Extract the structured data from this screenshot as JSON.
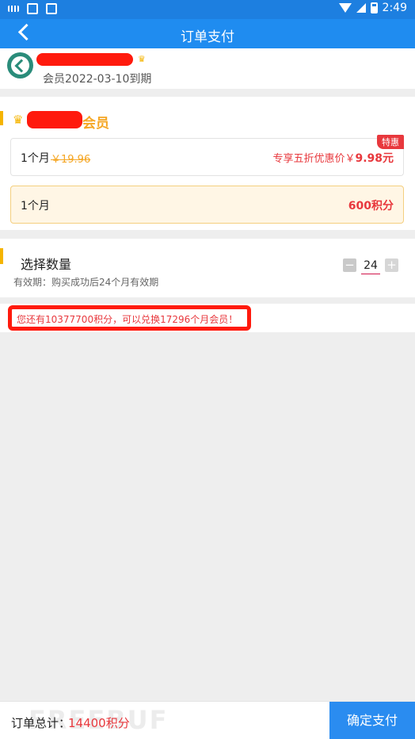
{
  "status_bar": {
    "time": "2:49",
    "icons": [
      "keyboard-icon",
      "image-icon",
      "a-icon",
      "wifi-icon",
      "signal-icon",
      "battery-icon"
    ]
  },
  "nav": {
    "title": "订单支付",
    "back_icon": "chevron-left-icon"
  },
  "user": {
    "expire": "会员2022-03-10到期"
  },
  "member": {
    "title_suffix": "会员",
    "option_price": {
      "label": "1个月",
      "original": "￥19.96",
      "promo_prefix": "专享五折优惠价￥",
      "promo_value": "9.98元",
      "badge": "特惠"
    },
    "option_points": {
      "label": "1个月",
      "points": "600积分"
    }
  },
  "quantity": {
    "title": "选择数量",
    "validity": "有效期：购买成功后24个月有效期",
    "value": "24",
    "minus": "−",
    "plus": "+"
  },
  "notice": "您还有10377700积分，可以兑换17296个月会员！",
  "footer": {
    "total_label": "订单总计：",
    "total_value": "14400积分",
    "watermark": "FREEBUF",
    "confirm": "确定支付"
  },
  "colors": {
    "primary": "#1f8cf0",
    "accent": "#f5b400",
    "price_red": "#e8383d",
    "highlight_red": "#ff1a0d"
  }
}
